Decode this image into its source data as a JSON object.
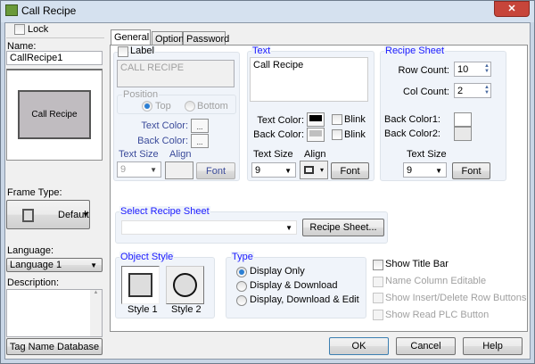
{
  "window": {
    "title": "Call Recipe",
    "close": "✕"
  },
  "left": {
    "lock_label": "Lock",
    "name_label": "Name:",
    "name_value": "CallRecipe1",
    "preview_button": "Call Recipe",
    "frame_type_label": "Frame Type:",
    "frame_type_value": "Default",
    "language_label": "Language:",
    "language_value": "Language 1",
    "description_label": "Description:",
    "description_value": "",
    "tag_db_button": "Tag Name Database"
  },
  "tabs": [
    {
      "label": "General",
      "active": true
    },
    {
      "label": "Option"
    },
    {
      "label": "Password"
    }
  ],
  "label_group": {
    "label": "Label",
    "text": "CALL RECIPE",
    "position_label": "Position",
    "top": "Top",
    "bottom": "Bottom",
    "text_color": "Text Color:",
    "back_color": "Back Color:",
    "text_size_label": "Text Size",
    "text_size": "9",
    "align_label": "Align",
    "font": "Font",
    "swatch_btn": "..."
  },
  "text_group": {
    "title": "Text",
    "text": "Call Recipe",
    "text_color": "Text Color:",
    "back_color": "Back Color:",
    "blink": "Blink",
    "text_size_label": "Text Size",
    "text_size": "9",
    "align_label": "Align",
    "font": "Font",
    "text_color_value": "#000000",
    "back_color_value": "#c0c0c0"
  },
  "recipe_group": {
    "title": "Recipe Sheet",
    "row_count_label": "Row Count:",
    "row_count": "10",
    "col_count_label": "Col Count:",
    "col_count": "2",
    "back_color1": "Back Color1:",
    "back_color2": "Back Color2:",
    "text_size_label": "Text Size",
    "text_size": "9",
    "font": "Font",
    "back_color1_value": "#ffffff",
    "back_color2_value": "#e8e8e8"
  },
  "select_sheet": {
    "title": "Select Recipe Sheet",
    "value": "",
    "button": "Recipe Sheet..."
  },
  "object_style": {
    "title": "Object Style",
    "style1": "Style 1",
    "style2": "Style 2"
  },
  "type": {
    "title": "Type",
    "options": [
      "Display Only",
      "Display & Download",
      "Display, Download & Edit"
    ],
    "selected": 0
  },
  "options": {
    "show_title_bar": "Show Title Bar",
    "name_col_editable": "Name Column Editable",
    "show_insert_delete": "Show Insert/Delete Row Buttons",
    "show_read_plc": "Show Read PLC Button"
  },
  "footer": {
    "ok": "OK",
    "cancel": "Cancel",
    "help": "Help"
  }
}
